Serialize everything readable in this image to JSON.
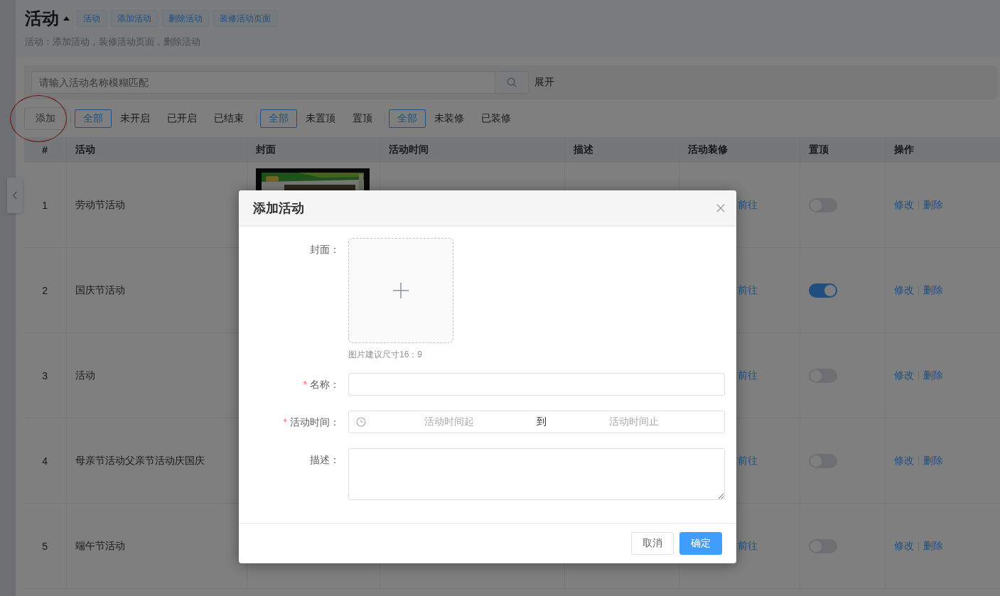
{
  "page_header": {
    "title": "活动",
    "tags": [
      "活动",
      "添加活动",
      "删除活动",
      "装修活动页面"
    ],
    "description": "活动：添加活动，装修活动页面，删除活动"
  },
  "search": {
    "placeholder": "请输入活动名称模糊匹配",
    "expand_label": "展开"
  },
  "toolbar": {
    "add_button": {
      "label": "添加",
      "circled": true
    },
    "filter_groups": [
      [
        {
          "label": "全部",
          "selected": true
        },
        {
          "label": "未开启",
          "selected": false
        },
        {
          "label": "已开启",
          "selected": false
        },
        {
          "label": "已结束",
          "selected": false
        }
      ],
      [
        {
          "label": "全部",
          "selected": true
        },
        {
          "label": "未置顶",
          "selected": false
        },
        {
          "label": "置顶",
          "selected": false
        }
      ],
      [
        {
          "label": "全部",
          "selected": true
        },
        {
          "label": "未装修",
          "selected": false
        },
        {
          "label": "已装修",
          "selected": false
        }
      ]
    ]
  },
  "table": {
    "columns": [
      "#",
      "活动",
      "封面",
      "活动时间",
      "描述",
      "活动装修",
      "置顶",
      "操作"
    ],
    "rows": [
      {
        "index": "1",
        "name": "劳动节活动",
        "cover": {
          "kind": "picture"
        },
        "decorate_link": "前往",
        "pinned": false,
        "actions": [
          "修改",
          "删除"
        ]
      },
      {
        "index": "2",
        "name": "国庆节活动",
        "decorate_link": "前往",
        "pinned": true,
        "actions": [
          "修改",
          "删除"
        ]
      },
      {
        "index": "3",
        "name": "活动",
        "decorate_link": "前往",
        "pinned": false,
        "actions": [
          "修改",
          "删除"
        ]
      },
      {
        "index": "4",
        "name": "母亲节活动父亲节活动庆国庆",
        "decorate_link": "前往",
        "pinned": false,
        "actions": [
          "修改",
          "删除"
        ]
      },
      {
        "index": "5",
        "name": "端午节活动",
        "decorate_link": "前往",
        "pinned": false,
        "actions": [
          "修改",
          "删除"
        ]
      }
    ]
  },
  "dialog": {
    "title": "添加活动",
    "fields": [
      {
        "kind": "upload",
        "label": "封面：",
        "hint": "图片建议尺寸16：9"
      },
      {
        "kind": "text",
        "label": "名称：",
        "required_mark": "*"
      },
      {
        "kind": "daterange",
        "label": "活动时间：",
        "required_mark": "*",
        "start_placeholder": "活动时间起",
        "separator": "到",
        "end_placeholder": "活动时间止"
      },
      {
        "kind": "textarea",
        "label": "描述："
      }
    ],
    "buttons": [
      {
        "label": "取消",
        "kind": "default"
      },
      {
        "label": "确定",
        "kind": "primary"
      }
    ]
  }
}
